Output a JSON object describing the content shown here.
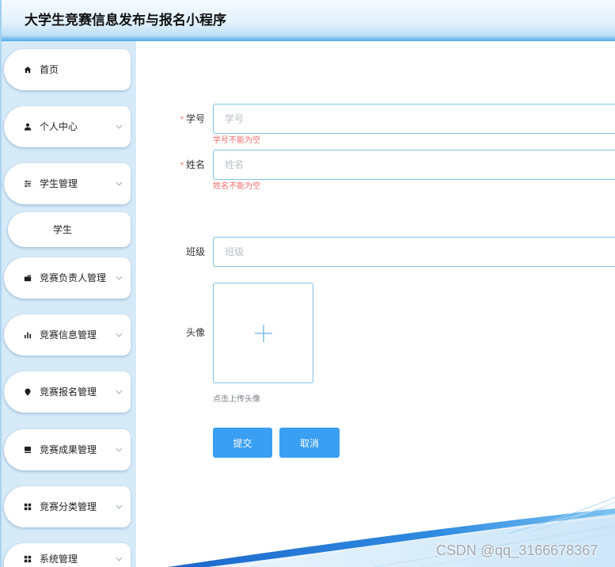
{
  "header": {
    "title": "大学生竞赛信息发布与报名小程序"
  },
  "sidebar": {
    "items": [
      {
        "label": "首页",
        "icon": "home-icon",
        "has_children": false
      },
      {
        "label": "个人中心",
        "icon": "user-icon",
        "has_children": true
      },
      {
        "label": "学生管理",
        "icon": "sliders-icon",
        "has_children": true
      },
      {
        "label": "学生",
        "submenu": true
      },
      {
        "label": "竞赛负责人管理",
        "icon": "briefcase-icon",
        "has_children": true
      },
      {
        "label": "竞赛信息管理",
        "icon": "bar-chart-icon",
        "has_children": true
      },
      {
        "label": "竞赛报名管理",
        "icon": "location-pin-icon",
        "has_children": true
      },
      {
        "label": "竞赛成果管理",
        "icon": "monitor-icon",
        "has_children": true
      },
      {
        "label": "竞赛分类管理",
        "icon": "grid-icon",
        "has_children": true
      },
      {
        "label": "系统管理",
        "icon": "grid-icon",
        "has_children": true
      }
    ]
  },
  "form": {
    "required_mark": "*",
    "fields": [
      {
        "label": "学号",
        "required": true,
        "value": "",
        "placeholder": "学号",
        "error": "学号不能为空"
      },
      {
        "label": "姓名",
        "required": true,
        "value": "",
        "placeholder": "姓名",
        "error": "姓名不能为空"
      },
      {
        "label": "班级",
        "required": false,
        "value": "",
        "placeholder": "班级"
      }
    ],
    "avatar": {
      "label": "头像",
      "hint": "点击上传头像",
      "icon": "plus-icon"
    },
    "submit_label": "提交",
    "cancel_label": "取消"
  },
  "watermark": "CSDN @qq_3166678367",
  "colors": {
    "accent": "#3a9ef2",
    "sidebar_background": "#d6eaf8",
    "error": "#f56c6c",
    "input_border": "#7fc2e6"
  }
}
